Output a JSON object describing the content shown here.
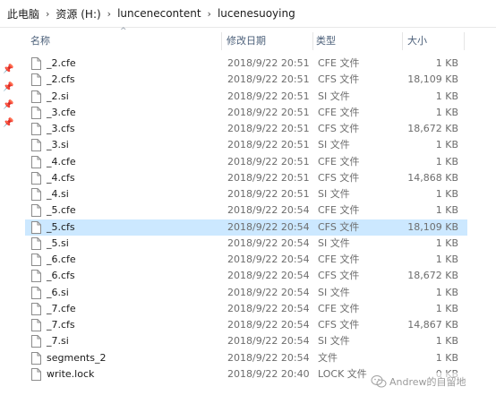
{
  "breadcrumb": {
    "items": [
      "此电脑",
      "资源 (H:)",
      "luncenecontent",
      "lucenesuoying"
    ],
    "separator": "›"
  },
  "columns": {
    "name": "名称",
    "date": "修改日期",
    "type": "类型",
    "size": "大小"
  },
  "files": [
    {
      "name": "_2.cfe",
      "date": "2018/9/22 20:51",
      "type": "CFE 文件",
      "size": "1 KB",
      "selected": false
    },
    {
      "name": "_2.cfs",
      "date": "2018/9/22 20:51",
      "type": "CFS 文件",
      "size": "18,109 KB",
      "selected": false
    },
    {
      "name": "_2.si",
      "date": "2018/9/22 20:51",
      "type": "SI 文件",
      "size": "1 KB",
      "selected": false
    },
    {
      "name": "_3.cfe",
      "date": "2018/9/22 20:51",
      "type": "CFE 文件",
      "size": "1 KB",
      "selected": false
    },
    {
      "name": "_3.cfs",
      "date": "2018/9/22 20:51",
      "type": "CFS 文件",
      "size": "18,672 KB",
      "selected": false
    },
    {
      "name": "_3.si",
      "date": "2018/9/22 20:51",
      "type": "SI 文件",
      "size": "1 KB",
      "selected": false
    },
    {
      "name": "_4.cfe",
      "date": "2018/9/22 20:51",
      "type": "CFE 文件",
      "size": "1 KB",
      "selected": false
    },
    {
      "name": "_4.cfs",
      "date": "2018/9/22 20:51",
      "type": "CFS 文件",
      "size": "14,868 KB",
      "selected": false
    },
    {
      "name": "_4.si",
      "date": "2018/9/22 20:51",
      "type": "SI 文件",
      "size": "1 KB",
      "selected": false
    },
    {
      "name": "_5.cfe",
      "date": "2018/9/22 20:54",
      "type": "CFE 文件",
      "size": "1 KB",
      "selected": false
    },
    {
      "name": "_5.cfs",
      "date": "2018/9/22 20:54",
      "type": "CFS 文件",
      "size": "18,109 KB",
      "selected": true
    },
    {
      "name": "_5.si",
      "date": "2018/9/22 20:54",
      "type": "SI 文件",
      "size": "1 KB",
      "selected": false
    },
    {
      "name": "_6.cfe",
      "date": "2018/9/22 20:54",
      "type": "CFE 文件",
      "size": "1 KB",
      "selected": false
    },
    {
      "name": "_6.cfs",
      "date": "2018/9/22 20:54",
      "type": "CFS 文件",
      "size": "18,672 KB",
      "selected": false
    },
    {
      "name": "_6.si",
      "date": "2018/9/22 20:54",
      "type": "SI 文件",
      "size": "1 KB",
      "selected": false
    },
    {
      "name": "_7.cfe",
      "date": "2018/9/22 20:54",
      "type": "CFE 文件",
      "size": "1 KB",
      "selected": false
    },
    {
      "name": "_7.cfs",
      "date": "2018/9/22 20:54",
      "type": "CFS 文件",
      "size": "14,867 KB",
      "selected": false
    },
    {
      "name": "_7.si",
      "date": "2018/9/22 20:54",
      "type": "SI 文件",
      "size": "1 KB",
      "selected": false
    },
    {
      "name": "segments_2",
      "date": "2018/9/22 20:54",
      "type": "文件",
      "size": "1 KB",
      "selected": false
    },
    {
      "name": "write.lock",
      "date": "2018/9/22 20:40",
      "type": "LOCK 文件",
      "size": "0 KB",
      "selected": false
    }
  ],
  "watermark": {
    "text": "Andrew的自留地",
    "icon": "wechat-icon"
  },
  "colors": {
    "selected_row": "#cce8ff",
    "header_text": "#4c607a",
    "secondary_text": "#6d6d6d"
  }
}
